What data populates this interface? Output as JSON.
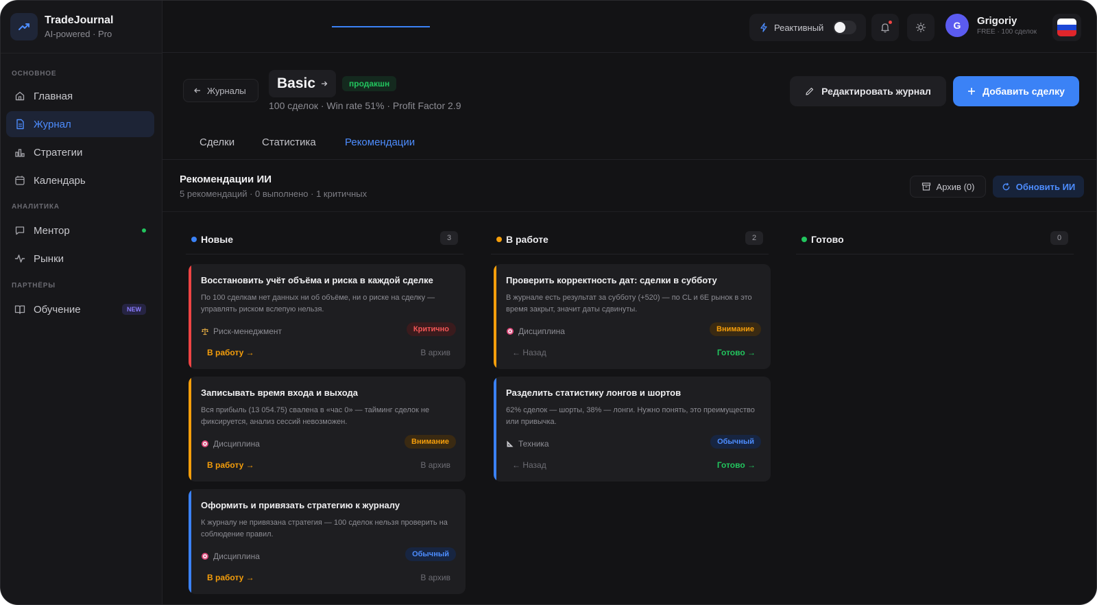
{
  "brand": {
    "name": "TradeJournal",
    "subtitle": "AI-powered · Pro"
  },
  "sidebar": {
    "sections": [
      {
        "label": "ОСНОВНОЕ"
      },
      {
        "label": "АНАЛИТИКА"
      },
      {
        "label": "ПАРТНЁРЫ"
      }
    ],
    "items": [
      {
        "label": "Главная",
        "icon": "home-icon"
      },
      {
        "label": "Журнал",
        "icon": "file-icon",
        "active": true
      },
      {
        "label": "Стратегии",
        "icon": "chart-icon"
      },
      {
        "label": "Календарь",
        "icon": "calendar-icon"
      },
      {
        "label": "Ментор",
        "icon": "chat-icon"
      },
      {
        "label": "Рынки",
        "icon": "pulse-icon"
      },
      {
        "label": "Обучение",
        "icon": "book-icon",
        "badge": "NEW"
      }
    ]
  },
  "topbar": {
    "reactive_label": "Реактивный",
    "user_initial": "G",
    "user_name": "Grigoriy",
    "user_plan": "FREE · 100 сделок"
  },
  "journal": {
    "back_label": "Журналы",
    "title": "Basic",
    "badge": "продакшн",
    "subtitle": "100 сделок · Win rate 51% · Profit Factor 2.9",
    "edit_label": "Редактировать журнал",
    "add_label": "Добавить сделку"
  },
  "tabs": [
    {
      "label": "Сделки"
    },
    {
      "label": "Статистика"
    },
    {
      "label": "Рекомендации",
      "active": true
    }
  ],
  "recommendations": {
    "title": "Рекомендации ИИ",
    "summary": "5 рекомендаций · 0 выполнено · 1 критичных",
    "archive_label": "Архив (0)",
    "refresh_label": "Обновить ИИ"
  },
  "columns": [
    {
      "label": "Новые",
      "count": "3",
      "color": "#3b82f6"
    },
    {
      "label": "В работе",
      "count": "2",
      "color": "#f59e0b"
    },
    {
      "label": "Готово",
      "count": "0",
      "color": "#22c55e"
    }
  ],
  "cards": {
    "new": [
      {
        "title": "Восстановить учёт объёма и риска в каждой сделке",
        "desc": "По 100 сделкам нет данных ни об объёме, ни о риске на сделку — управлять риском вслепую нельзя.",
        "category": "Риск-менеджмент",
        "priority": "Критично",
        "action": "В работу →",
        "secondary": "В архив"
      },
      {
        "title": "Записывать время входа и выхода",
        "desc": "Вся прибыль (13 054.75) свалена в «час 0» — тайминг сделок не фиксируется, анализ сессий невозможен.",
        "category": "Дисциплина",
        "priority": "Внимание",
        "action": "В работу →",
        "secondary": "В архив"
      },
      {
        "title": "Оформить и привязать стратегию к журналу",
        "desc": "К журналу не привязана стратегия — 100 сделок нельзя проверить на соблюдение правил.",
        "category": "Дисциплина",
        "priority": "Обычный",
        "action": "В работу →",
        "secondary": "В архив"
      }
    ],
    "in_progress": [
      {
        "title": "Проверить корректность дат: сделки в субботу",
        "desc": "В журнале есть результат за субботу (+520) — по CL и 6E рынок в это время закрыт, значит даты сдвинуты.",
        "category": "Дисциплина",
        "priority": "Внимание",
        "action": "← Назад",
        "secondary": "Готово →"
      },
      {
        "title": "Разделить статистику лонгов и шортов",
        "desc": "62% сделок — шорты, 38% — лонги. Нужно понять, это преимущество или привычка.",
        "category": "Техника",
        "priority": "Обычный",
        "action": "← Назад",
        "secondary": "Готово →"
      }
    ]
  },
  "colors": {
    "accent": "#3b82f6",
    "critical": "#f25656",
    "warning": "#f59e0b",
    "success": "#22c55e"
  }
}
